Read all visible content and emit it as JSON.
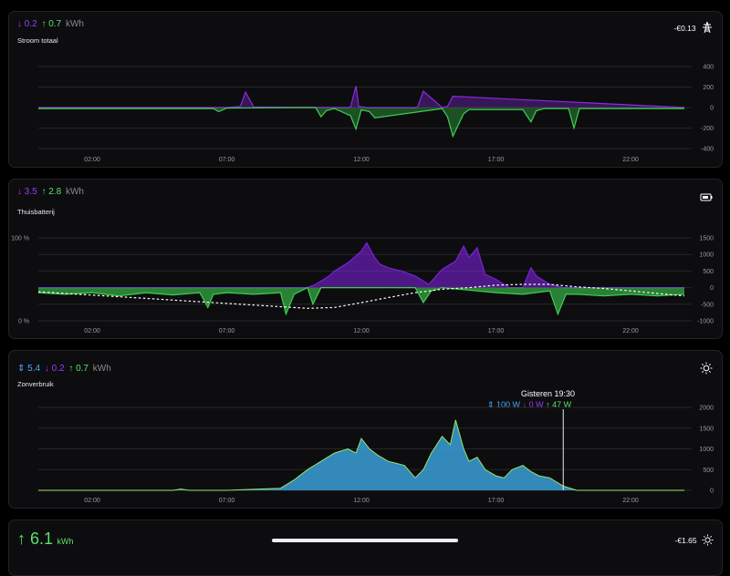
{
  "cards": [
    {
      "down": "↓ 0.2",
      "up": "↑ 0.7",
      "unit": "kWh",
      "title": "Stroom totaal",
      "right_value": "-€0.13",
      "icon": "power-tower-icon"
    },
    {
      "down": "↓ 3.5",
      "up": "↑ 2.8",
      "unit": "kWh",
      "title": "Thuisbatterij",
      "icon": "battery-icon"
    },
    {
      "both": "⇕ 5.4",
      "down": "↓ 0.2",
      "up": "↑ 0.7",
      "unit": "kWh",
      "title": "Zonverbruik",
      "icon": "sun-icon",
      "tooltip": {
        "time": "Gisteren 19:30",
        "both": "⇕ 100 W",
        "down": "↓ 0 W",
        "up": "↑ 47 W"
      }
    },
    {
      "up": "↑ 6.1",
      "unit": "kWh",
      "right_value": "-€1.65",
      "icon": "sun-icon"
    }
  ],
  "chart_data": [
    {
      "type": "line",
      "x_ticks": [
        "02:00",
        "07:00",
        "12:00",
        "17:00",
        "22:00"
      ],
      "x_tick_hours": [
        2,
        7,
        12,
        17,
        22
      ],
      "y_ticks": [
        400,
        200,
        0,
        -200,
        -400
      ],
      "ylim": [
        -400,
        400
      ],
      "series": [
        {
          "color": "#8a2be2",
          "x": [
            0,
            7,
            7.5,
            7.7,
            8,
            11.5,
            11.6,
            11.8,
            11.9,
            12.2,
            14,
            14.1,
            14.3,
            15,
            15.2,
            15.4,
            24
          ],
          "y": [
            0,
            0,
            10,
            150,
            5,
            0,
            5,
            210,
            10,
            0,
            0,
            10,
            160,
            0,
            10,
            110,
            0
          ]
        },
        {
          "color": "#3ecf4f",
          "x": [
            0,
            6.5,
            6.7,
            7,
            10.3,
            10.5,
            10.7,
            11,
            11.6,
            11.8,
            12,
            12.3,
            12.5,
            15,
            15.2,
            15.4,
            15.8,
            16,
            18,
            18.3,
            18.5,
            18.8,
            19.7,
            19.9,
            20.1,
            24
          ],
          "y": [
            -10,
            -10,
            -40,
            -5,
            0,
            -90,
            -30,
            -10,
            -80,
            -210,
            -20,
            -40,
            -100,
            -10,
            -90,
            -280,
            -60,
            -20,
            -20,
            -140,
            -30,
            -10,
            -10,
            -200,
            -10,
            -10
          ]
        }
      ]
    },
    {
      "type": "area",
      "x_ticks": [
        "02:00",
        "07:00",
        "12:00",
        "17:00",
        "22:00"
      ],
      "x_tick_hours": [
        2,
        7,
        12,
        17,
        22
      ],
      "y_left_ticks": [
        "100 %",
        "0 %"
      ],
      "y_right_ticks": [
        1500,
        1000,
        500,
        0,
        -500,
        -1000
      ],
      "ylim": [
        -1000,
        1500
      ],
      "soc_ylim": [
        0,
        100
      ],
      "series": [
        {
          "name": "",
          "color": "#7a22d6",
          "x": [
            0,
            10,
            10.3,
            10.8,
            11,
            11.5,
            12,
            12.2,
            12.5,
            12.7,
            13,
            13.5,
            14,
            14.5,
            15,
            15.5,
            15.8,
            16,
            16.3,
            16.6,
            17,
            17.5,
            18,
            18.3,
            18.5,
            19,
            19.5,
            24
          ],
          "y": [
            0,
            0,
            100,
            350,
            500,
            750,
            1100,
            1350,
            900,
            700,
            600,
            500,
            350,
            100,
            550,
            800,
            1250,
            900,
            1200,
            400,
            250,
            0,
            0,
            600,
            350,
            100,
            0,
            0
          ]
        },
        {
          "name": "",
          "color": "#3ecf4f",
          "x": [
            0,
            1,
            2,
            3,
            4,
            5,
            6,
            6.3,
            6.5,
            7,
            8,
            9,
            9.2,
            9.5,
            10,
            10.2,
            10.5,
            11,
            12,
            13,
            14,
            14.3,
            14.6,
            15,
            17,
            18,
            19,
            19.3,
            19.6,
            20,
            21,
            22,
            23,
            24
          ],
          "y": [
            -150,
            -200,
            -150,
            -250,
            -150,
            -220,
            -150,
            -600,
            -200,
            -150,
            -200,
            -150,
            -800,
            -200,
            0,
            -500,
            0,
            0,
            0,
            0,
            0,
            -450,
            -100,
            0,
            -150,
            -200,
            -100,
            -800,
            -200,
            -200,
            -250,
            -200,
            -250,
            -200
          ]
        }
      ],
      "soc": {
        "x": [
          0,
          2,
          4,
          6,
          8,
          10,
          11,
          12,
          13,
          14,
          15,
          16,
          17,
          18,
          19,
          20,
          21,
          22,
          23,
          24
        ],
        "y": [
          35,
          31,
          27,
          23,
          19,
          15,
          16,
          22,
          28,
          34,
          38,
          40,
          43,
          44,
          44,
          41,
          39,
          36,
          33,
          30
        ]
      }
    },
    {
      "type": "area",
      "x_ticks": [
        "02:00",
        "07:00",
        "12:00",
        "17:00",
        "22:00"
      ],
      "x_tick_hours": [
        2,
        7,
        12,
        17,
        22
      ],
      "y_ticks": [
        2000,
        1500,
        1000,
        500,
        0
      ],
      "ylim": [
        0,
        2000
      ],
      "tooltip_hour": 19.5,
      "series": [
        {
          "name": "",
          "color": "#3aa0d8",
          "x": [
            0,
            5,
            5.3,
            5.6,
            7,
            9,
            9.5,
            10,
            10.5,
            11,
            11.5,
            11.8,
            12,
            12.3,
            12.6,
            13,
            13.3,
            13.6,
            14,
            14.3,
            14.6,
            15,
            15.3,
            15.5,
            15.8,
            16,
            16.3,
            16.6,
            17,
            17.3,
            17.6,
            18,
            18.3,
            18.6,
            19,
            19.5,
            20,
            24
          ],
          "y": [
            0,
            0,
            30,
            0,
            0,
            50,
            250,
            500,
            700,
            900,
            1000,
            900,
            1250,
            1000,
            850,
            700,
            650,
            600,
            300,
            500,
            900,
            1300,
            1100,
            1700,
            1000,
            700,
            800,
            500,
            350,
            300,
            500,
            600,
            450,
            350,
            300,
            100,
            0,
            0
          ]
        }
      ]
    }
  ]
}
